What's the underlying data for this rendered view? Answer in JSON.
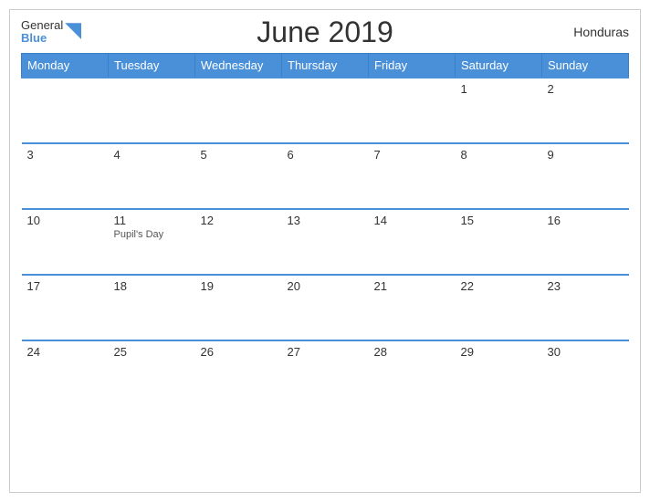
{
  "header": {
    "logo_general": "General",
    "logo_blue": "Blue",
    "month_title": "June 2019",
    "country": "Honduras"
  },
  "weekdays": [
    "Monday",
    "Tuesday",
    "Wednesday",
    "Thursday",
    "Friday",
    "Saturday",
    "Sunday"
  ],
  "weeks": [
    [
      {
        "day": "",
        "holiday": "",
        "empty": true
      },
      {
        "day": "",
        "holiday": "",
        "empty": true
      },
      {
        "day": "",
        "holiday": "",
        "empty": true
      },
      {
        "day": "",
        "holiday": "",
        "empty": true
      },
      {
        "day": "",
        "holiday": "",
        "empty": true
      },
      {
        "day": "1",
        "holiday": ""
      },
      {
        "day": "2",
        "holiday": ""
      }
    ],
    [
      {
        "day": "3",
        "holiday": ""
      },
      {
        "day": "4",
        "holiday": ""
      },
      {
        "day": "5",
        "holiday": ""
      },
      {
        "day": "6",
        "holiday": ""
      },
      {
        "day": "7",
        "holiday": ""
      },
      {
        "day": "8",
        "holiday": ""
      },
      {
        "day": "9",
        "holiday": ""
      }
    ],
    [
      {
        "day": "10",
        "holiday": ""
      },
      {
        "day": "11",
        "holiday": "Pupil's Day"
      },
      {
        "day": "12",
        "holiday": ""
      },
      {
        "day": "13",
        "holiday": ""
      },
      {
        "day": "14",
        "holiday": ""
      },
      {
        "day": "15",
        "holiday": ""
      },
      {
        "day": "16",
        "holiday": ""
      }
    ],
    [
      {
        "day": "17",
        "holiday": ""
      },
      {
        "day": "18",
        "holiday": ""
      },
      {
        "day": "19",
        "holiday": ""
      },
      {
        "day": "20",
        "holiday": ""
      },
      {
        "day": "21",
        "holiday": ""
      },
      {
        "day": "22",
        "holiday": ""
      },
      {
        "day": "23",
        "holiday": ""
      }
    ],
    [
      {
        "day": "24",
        "holiday": ""
      },
      {
        "day": "25",
        "holiday": ""
      },
      {
        "day": "26",
        "holiday": ""
      },
      {
        "day": "27",
        "holiday": ""
      },
      {
        "day": "28",
        "holiday": ""
      },
      {
        "day": "29",
        "holiday": ""
      },
      {
        "day": "30",
        "holiday": ""
      }
    ]
  ]
}
